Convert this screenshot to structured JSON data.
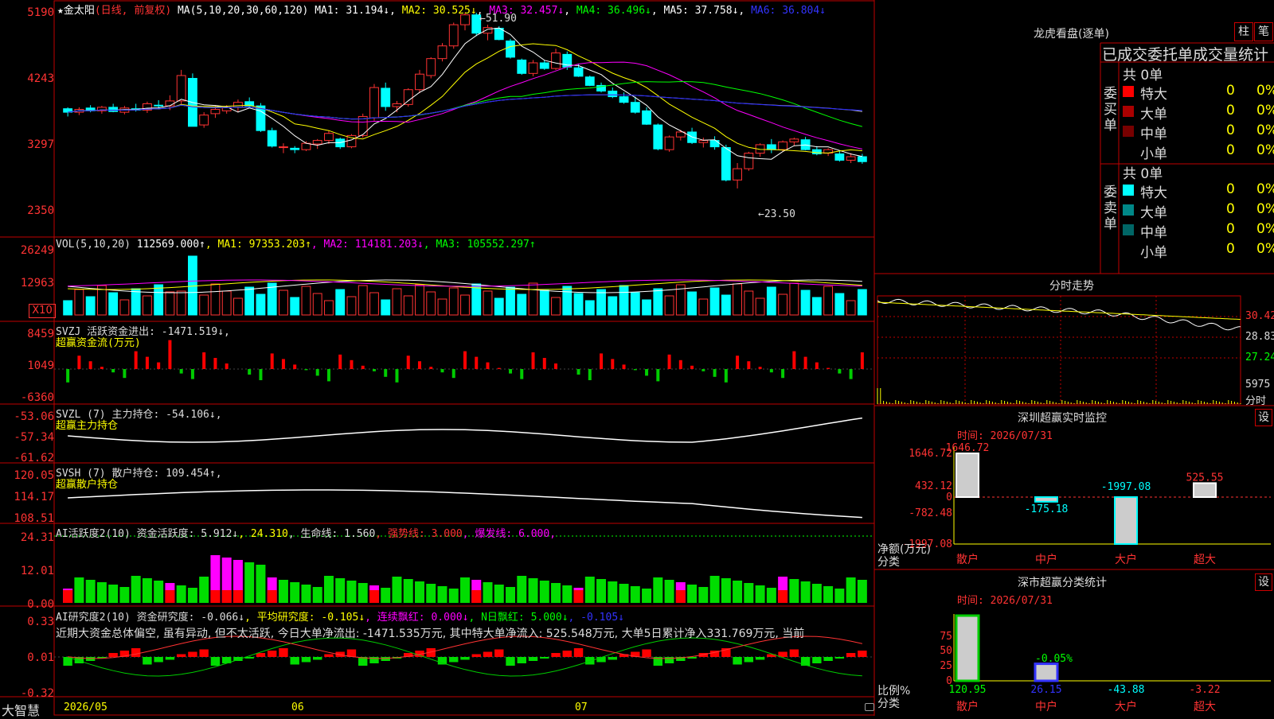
{
  "stock": {
    "name": "金太阳",
    "mode": "(日线, 前复权)",
    "star": "★"
  },
  "colors": {
    "up": "#ff3333",
    "down": "#00ffff",
    "ma1": "#ffffff",
    "ma2": "#ffff00",
    "ma3": "#ff00ff",
    "ma4": "#00ff00",
    "ma5": "#c0c0c0",
    "ma6": "#2222ff",
    "border": "#c00000"
  },
  "main": {
    "legend_prefix": "MA(5,10,20,30,60,120)",
    "ma": [
      {
        "label": "MA1: 31.194↓",
        "color": "#ffffff"
      },
      {
        "label": "MA2: 30.525↓",
        "color": "#ffff00"
      },
      {
        "label": "MA3: 32.457↓",
        "color": "#ff00ff"
      },
      {
        "label": "MA4: 36.496↓",
        "color": "#00ff00"
      },
      {
        "label": "MA5: 37.758↓",
        "color": "#ffffff"
      },
      {
        "label": "MA6: 36.804↓",
        "color": "#3333ff"
      }
    ],
    "y_ticks": [
      "5190",
      "4243",
      "3297",
      "2350"
    ],
    "high_label": "←51.90",
    "low_label": "←23.50"
  },
  "vol": {
    "legend": [
      "VOL(5,10,20)",
      " 112569.000↑",
      ", MA1: 97353.203↑",
      ", MA2: 114181.203↓",
      ", MA3: 105552.297↑"
    ],
    "legend_colors": [
      "#ddd",
      "#ffffff",
      "#ffff00",
      "#ff00ff",
      "#00ff00"
    ],
    "y_ticks": [
      "26249",
      "12963"
    ],
    "unit": "X10"
  },
  "svzj": {
    "line1": "SVZJ  活跃资金进出: -1471.519↓,",
    "line2": "超赢资金流(万元)",
    "y_ticks": [
      "8459",
      "1049",
      "-6360"
    ]
  },
  "svzl": {
    "line1": "SVZL (7) 主力持仓: -54.106↓,",
    "line2": "超赢主力持仓",
    "y_ticks": [
      "-53.06",
      "-57.34",
      "-61.62"
    ]
  },
  "svsh": {
    "line1": "SVSH (7) 散户持仓: 109.454↑,",
    "line2": "超赢散户持仓",
    "y_ticks": [
      "120.05",
      "114.17",
      "108.51"
    ]
  },
  "ai1": {
    "legend": [
      "AI活跃度2(10) 资金活跃度: 5.912↓",
      ", 24.310",
      ", 生命线: 1.560",
      ", 强势线: 3.000",
      ", 爆发线: 6.000,"
    ],
    "legend_colors": [
      "#ddd",
      "#ffff00",
      "#ddd",
      "#ff3333",
      "#ff00ff"
    ],
    "y_ticks": [
      "24.31",
      "12.01",
      "0.00"
    ]
  },
  "ai2": {
    "legend": [
      "AI研究度2(10) 资金研究度: -0.066↓",
      ", 平均研究度: -0.105↓",
      ", 连续飘红: 0.000↓",
      ", N日飘红: 5.000↓",
      ", -0.105↓"
    ],
    "legend_colors": [
      "#ddd",
      "#ffff00",
      "#ff00ff",
      "#00ff00",
      "#3333ff"
    ],
    "comment": "近期大资金总体偏空, 虽有异动, 但不太活跃, 今日大单净流出: -1471.535万元, 其中特大单净流入: 525.548万元, 大单5日累计净入331.769万元, 当前",
    "y_ticks": [
      "0.33",
      "0.01",
      "-0.32"
    ]
  },
  "bottom": {
    "brand": "大智慧",
    "dates": [
      "2026/05",
      "06",
      "07"
    ]
  },
  "right": {
    "title": "龙虎看盘(逐单)",
    "btn_bar": "柱",
    "btn_pen": "笔",
    "tabs_title": "已成交委托单成交量统计",
    "buy": {
      "side_label": "委买单",
      "total": "共 0单",
      "rows": [
        {
          "name": "特大",
          "count": "0",
          "pct": "0%",
          "color": "#ff0000"
        },
        {
          "name": "大单",
          "count": "0",
          "pct": "0%",
          "color": "#aa0000"
        },
        {
          "name": "中单",
          "count": "0",
          "pct": "0%",
          "color": "#770000"
        },
        {
          "name": "小单",
          "count": "0",
          "pct": "0%",
          "color": "#000000"
        }
      ]
    },
    "sell": {
      "side_label": "委卖单",
      "total": "共 0单",
      "rows": [
        {
          "name": "特大",
          "count": "0",
          "pct": "0%",
          "color": "#00ffff"
        },
        {
          "name": "大单",
          "count": "0",
          "pct": "0%",
          "color": "#008888"
        },
        {
          "name": "中单",
          "count": "0",
          "pct": "0%",
          "color": "#006666"
        },
        {
          "name": "小单",
          "count": "0",
          "pct": "0%",
          "color": "#000000"
        }
      ]
    },
    "intraday": {
      "title": "分时走势",
      "y_ticks": [
        "30.42",
        "28.83",
        "27.24"
      ],
      "vol_label": "5975",
      "footer": "分时"
    },
    "monitor": {
      "title": "深圳超赢实时监控",
      "set": "设",
      "time": "时间: 2026/07/31",
      "y_ticks": [
        "1646.72",
        "432.12",
        "0",
        "-782.48",
        "-1997.08"
      ],
      "unit_line1": "净额(万元)",
      "unit_line2": "分类",
      "categories": [
        "散户",
        "中户",
        "大户",
        "超大"
      ],
      "values": [
        1646.72,
        -175.18,
        -1997.08,
        525.55
      ],
      "value_labels": [
        "1646.72",
        "-175.18",
        "-1997.08",
        "525.55"
      ]
    },
    "classify": {
      "title": "深市超赢分类统计",
      "set": "设",
      "time": "时间: 2026/07/31",
      "y_ticks": [
        "75",
        "50",
        "25",
        "0"
      ],
      "unit_line1": "比例%",
      "unit_line2": "分类",
      "categories": [
        "散户",
        "中户",
        "大户",
        "超大"
      ],
      "bar_values": [
        100,
        26.15,
        0,
        0
      ],
      "value_labels": [
        "120.95",
        "26.15",
        "-43.88",
        "-3.22"
      ],
      "pct_label": "-0.05%"
    }
  },
  "chart_data": {
    "type": "candlestick",
    "title": "金太阳 (日线, 前复权)",
    "y_range": [
      2350,
      5190
    ],
    "high": 51.9,
    "low": 23.5,
    "candles": [
      [
        3830,
        3850,
        3720,
        3780,
        0
      ],
      [
        3780,
        3850,
        3740,
        3820,
        1
      ],
      [
        3840,
        3880,
        3780,
        3800,
        0
      ],
      [
        3800,
        3870,
        3760,
        3850,
        1
      ],
      [
        3850,
        3900,
        3780,
        3790,
        0
      ],
      [
        3780,
        3870,
        3750,
        3840,
        1
      ],
      [
        3830,
        3900,
        3790,
        3810,
        0
      ],
      [
        3810,
        3930,
        3770,
        3900,
        1
      ],
      [
        3880,
        3950,
        3820,
        3870,
        0
      ],
      [
        3870,
        4020,
        3810,
        3940,
        1
      ],
      [
        3940,
        4380,
        3880,
        4300,
        1
      ],
      [
        4260,
        4330,
        3600,
        3580,
        0
      ],
      [
        3600,
        3780,
        3560,
        3740,
        1
      ],
      [
        3760,
        3880,
        3700,
        3820,
        1
      ],
      [
        3800,
        3880,
        3760,
        3850,
        1
      ],
      [
        3850,
        3960,
        3780,
        3920,
        1
      ],
      [
        3930,
        3990,
        3840,
        3870,
        0
      ],
      [
        3870,
        3910,
        3500,
        3520,
        0
      ],
      [
        3520,
        3560,
        3280,
        3300,
        0
      ],
      [
        3280,
        3340,
        3200,
        3290,
        1
      ],
      [
        3270,
        3300,
        3200,
        3250,
        0
      ],
      [
        3250,
        3370,
        3230,
        3340,
        1
      ],
      [
        3330,
        3400,
        3260,
        3380,
        1
      ],
      [
        3380,
        3520,
        3330,
        3480,
        1
      ],
      [
        3400,
        3420,
        3260,
        3290,
        0
      ],
      [
        3290,
        3470,
        3270,
        3450,
        1
      ],
      [
        3450,
        3760,
        3420,
        3720,
        1
      ],
      [
        3700,
        4180,
        3660,
        4130,
        1
      ],
      [
        4120,
        4200,
        3800,
        3860,
        0
      ],
      [
        3860,
        3940,
        3780,
        3900,
        1
      ],
      [
        3890,
        4120,
        3860,
        4100,
        1
      ],
      [
        4100,
        4380,
        4050,
        4320,
        1
      ],
      [
        4300,
        4560,
        4260,
        4540,
        1
      ],
      [
        4540,
        4760,
        4500,
        4720,
        1
      ],
      [
        4720,
        5050,
        4680,
        5020,
        1
      ],
      [
        5020,
        5190,
        4940,
        5160,
        1
      ],
      [
        5160,
        5190,
        4860,
        4900,
        0
      ],
      [
        4900,
        5020,
        4800,
        4980,
        1
      ],
      [
        4970,
        5000,
        4800,
        4810,
        0
      ],
      [
        4790,
        4820,
        4540,
        4560,
        0
      ],
      [
        4520,
        4540,
        4310,
        4330,
        0
      ],
      [
        4330,
        4520,
        4290,
        4480,
        1
      ],
      [
        4480,
        4520,
        4380,
        4400,
        0
      ],
      [
        4400,
        4680,
        4380,
        4620,
        1
      ],
      [
        4600,
        4640,
        4380,
        4420,
        0
      ],
      [
        4410,
        4470,
        4280,
        4290,
        0
      ],
      [
        4280,
        4300,
        4150,
        4160,
        0
      ],
      [
        4160,
        4200,
        4060,
        4080,
        0
      ],
      [
        4080,
        4130,
        3980,
        4000,
        0
      ],
      [
        4000,
        4060,
        3900,
        3920,
        0
      ],
      [
        3920,
        4000,
        3760,
        3780,
        0
      ],
      [
        3800,
        3850,
        3600,
        3610,
        0
      ],
      [
        3600,
        3620,
        3240,
        3260,
        0
      ],
      [
        3250,
        3450,
        3220,
        3430,
        1
      ],
      [
        3430,
        3530,
        3380,
        3500,
        1
      ],
      [
        3500,
        3560,
        3330,
        3350,
        0
      ],
      [
        3350,
        3420,
        3280,
        3380,
        1
      ],
      [
        3380,
        3440,
        3250,
        3290,
        0
      ],
      [
        3280,
        3320,
        2800,
        2820,
        0
      ],
      [
        2820,
        3060,
        2700,
        2980,
        1
      ],
      [
        2980,
        3220,
        2950,
        3200,
        1
      ],
      [
        3200,
        3340,
        3150,
        3320,
        1
      ],
      [
        3320,
        3400,
        3200,
        3250,
        0
      ],
      [
        3250,
        3380,
        3220,
        3360,
        1
      ],
      [
        3360,
        3420,
        3300,
        3400,
        1
      ],
      [
        3390,
        3430,
        3240,
        3250,
        0
      ],
      [
        3250,
        3300,
        3170,
        3190,
        0
      ],
      [
        3200,
        3270,
        3160,
        3250,
        1
      ],
      [
        3190,
        3230,
        3080,
        3100,
        0
      ],
      [
        3100,
        3200,
        3060,
        3150,
        1
      ],
      [
        3150,
        3190,
        3050,
        3080,
        0
      ]
    ]
  }
}
